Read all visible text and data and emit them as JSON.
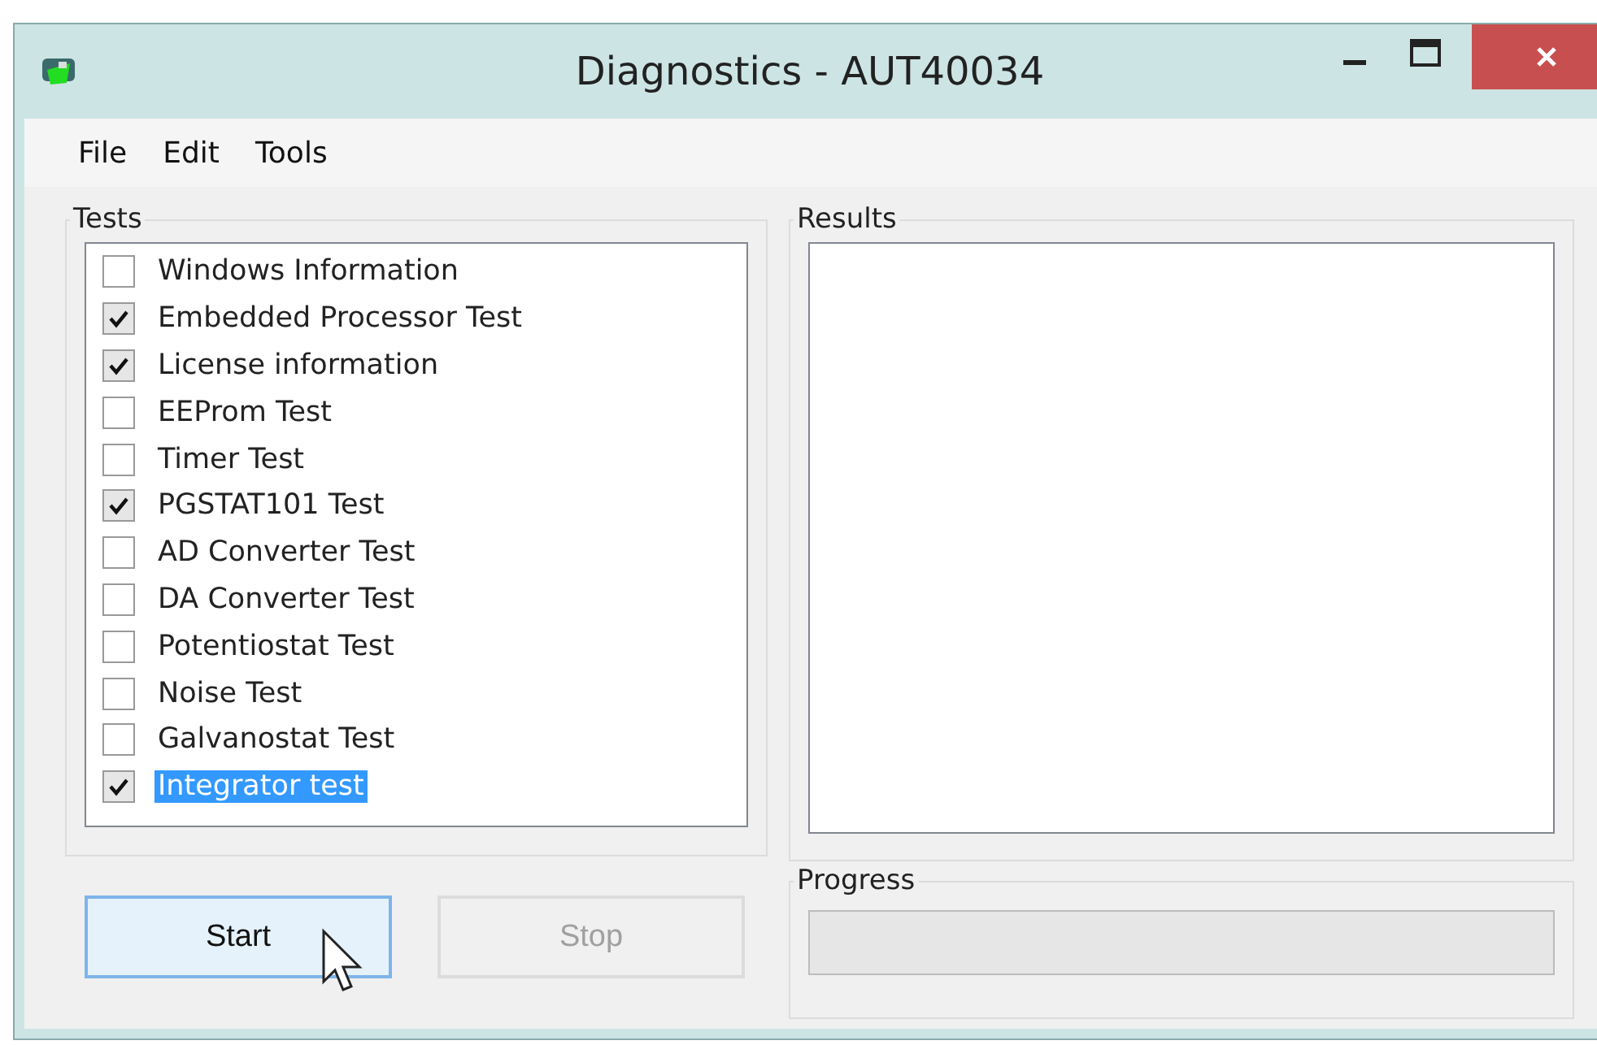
{
  "window": {
    "title": "Diagnostics - AUT40034"
  },
  "menu": [
    "File",
    "Edit",
    "Tools"
  ],
  "tests": {
    "title": "Tests",
    "items": [
      {
        "label": "Windows Information",
        "checked": false,
        "selected": false
      },
      {
        "label": "Embedded Processor Test",
        "checked": true,
        "selected": false
      },
      {
        "label": "License information",
        "checked": true,
        "selected": false
      },
      {
        "label": "EEProm Test",
        "checked": false,
        "selected": false
      },
      {
        "label": "Timer Test",
        "checked": false,
        "selected": false
      },
      {
        "label": "PGSTAT101 Test",
        "checked": true,
        "selected": false
      },
      {
        "label": "AD Converter Test",
        "checked": false,
        "selected": false
      },
      {
        "label": "DA Converter Test",
        "checked": false,
        "selected": false
      },
      {
        "label": "Potentiostat Test",
        "checked": false,
        "selected": false
      },
      {
        "label": "Noise Test",
        "checked": false,
        "selected": false
      },
      {
        "label": "Galvanostat Test",
        "checked": false,
        "selected": false
      },
      {
        "label": "Integrator test",
        "checked": true,
        "selected": true
      }
    ]
  },
  "buttons": [
    {
      "label": "Start",
      "disabled": false
    },
    {
      "label": "Stop",
      "disabled": true
    }
  ],
  "results": {
    "title": "Results"
  },
  "progress": {
    "title": "Progress",
    "level": 0
  }
}
